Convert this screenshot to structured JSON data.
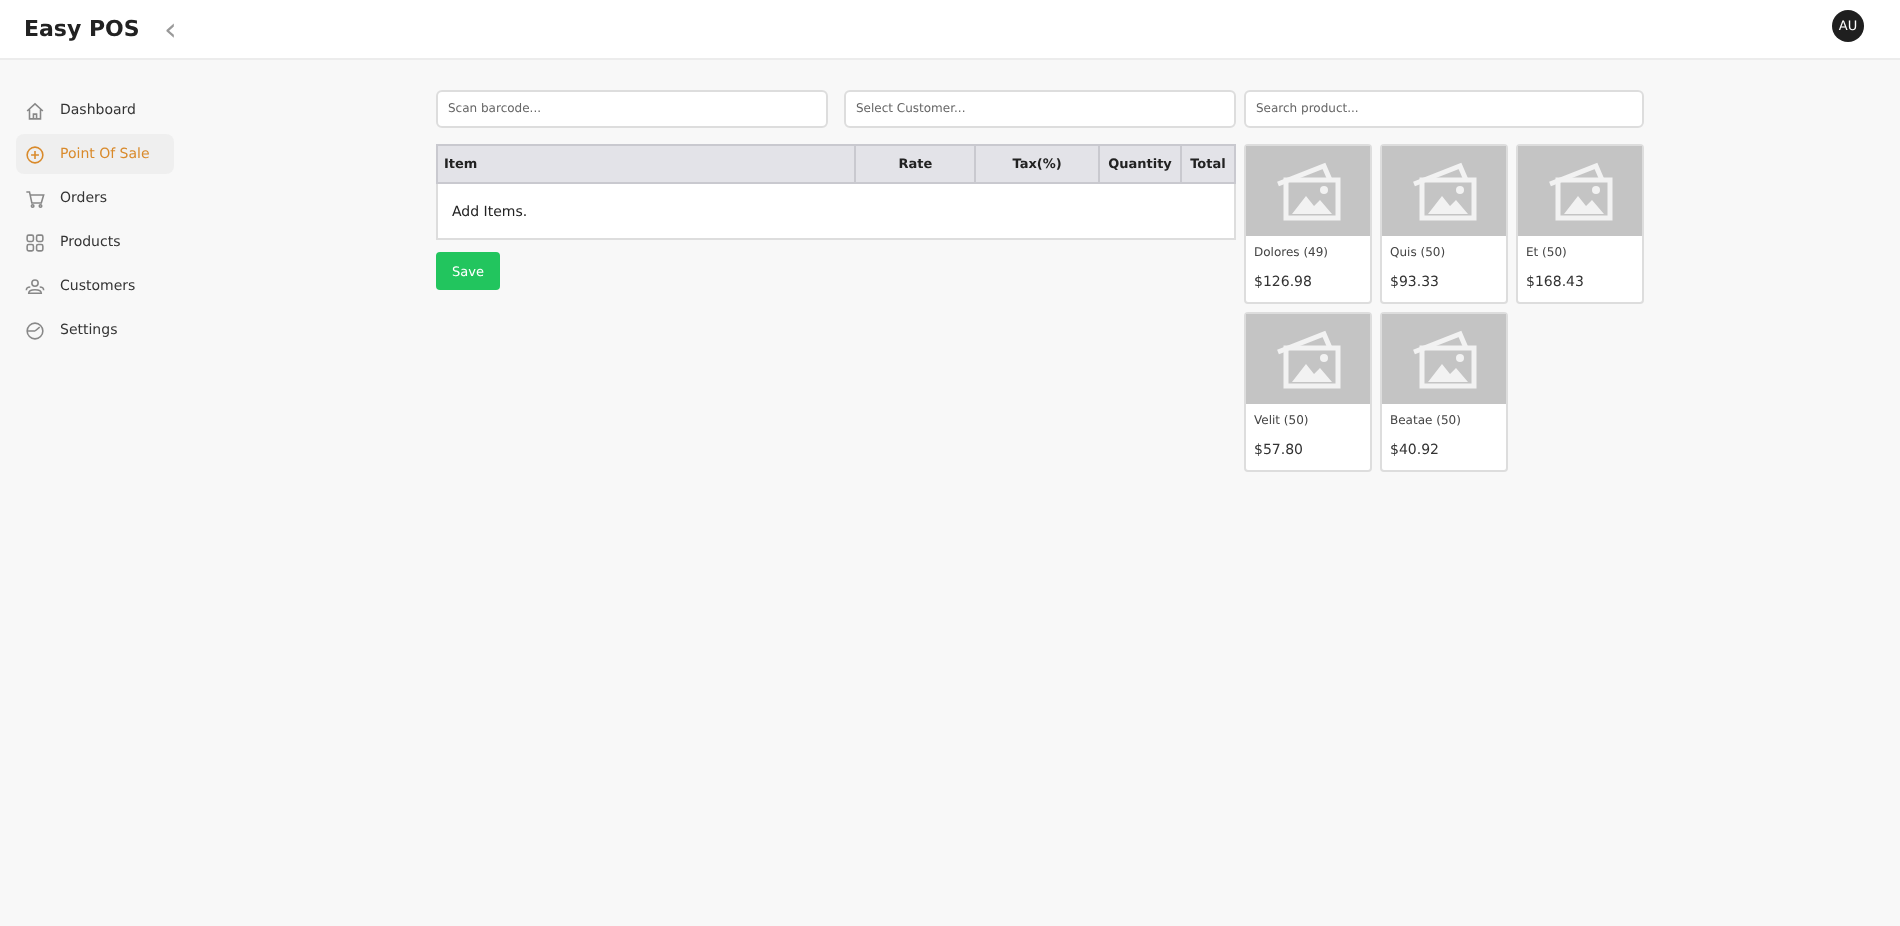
{
  "header": {
    "title": "Easy POS",
    "collapse_icon": "‹",
    "avatar": "AU"
  },
  "sidebar": {
    "items": [
      {
        "label": "Dashboard",
        "selected": false
      },
      {
        "label": "Point Of Sale",
        "selected": true
      },
      {
        "label": "Orders",
        "selected": false
      },
      {
        "label": "Products",
        "selected": false
      },
      {
        "label": "Customers",
        "selected": false
      },
      {
        "label": "Settings",
        "selected": false
      }
    ]
  },
  "pos": {
    "barcode": {
      "placeholder": "Scan barcode..."
    },
    "customer": {
      "placeholder": "Select Customer..."
    },
    "table": {
      "columns": [
        "Item",
        "Rate",
        "Tax(%)",
        "Quantity",
        "Total"
      ],
      "empty_text": "Add Items."
    },
    "save_button": "Save"
  },
  "products": {
    "search": {
      "placeholder": "Search product..."
    },
    "items": [
      {
        "name": "Dolores (49)",
        "price": "$126.98"
      },
      {
        "name": "Quis (50)",
        "price": "$93.33"
      },
      {
        "name": "Et (50)",
        "price": "$168.43"
      },
      {
        "name": "Velit (50)",
        "price": "$57.80"
      },
      {
        "name": "Beatae (50)",
        "price": "$40.92"
      }
    ]
  }
}
